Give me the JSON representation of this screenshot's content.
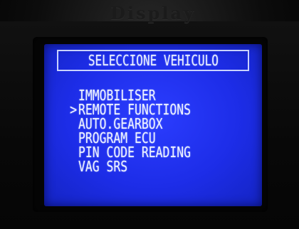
{
  "device": {
    "label": "Display"
  },
  "screen": {
    "title": "SELECCIONE VEHICULO",
    "cursor_glyph": ">",
    "menu": [
      {
        "label": "IMMOBILISER",
        "selected": false
      },
      {
        "label": "REMOTE FUNCTIONS",
        "selected": true
      },
      {
        "label": "AUTO.GEARBOX",
        "selected": false
      },
      {
        "label": "PROGRAM ECU",
        "selected": false
      },
      {
        "label": "PIN CODE READING",
        "selected": false
      },
      {
        "label": "VAG SRS",
        "selected": false
      }
    ]
  },
  "colors": {
    "lcd_background": "#1d2de8",
    "lcd_text": "#eef2ff"
  }
}
